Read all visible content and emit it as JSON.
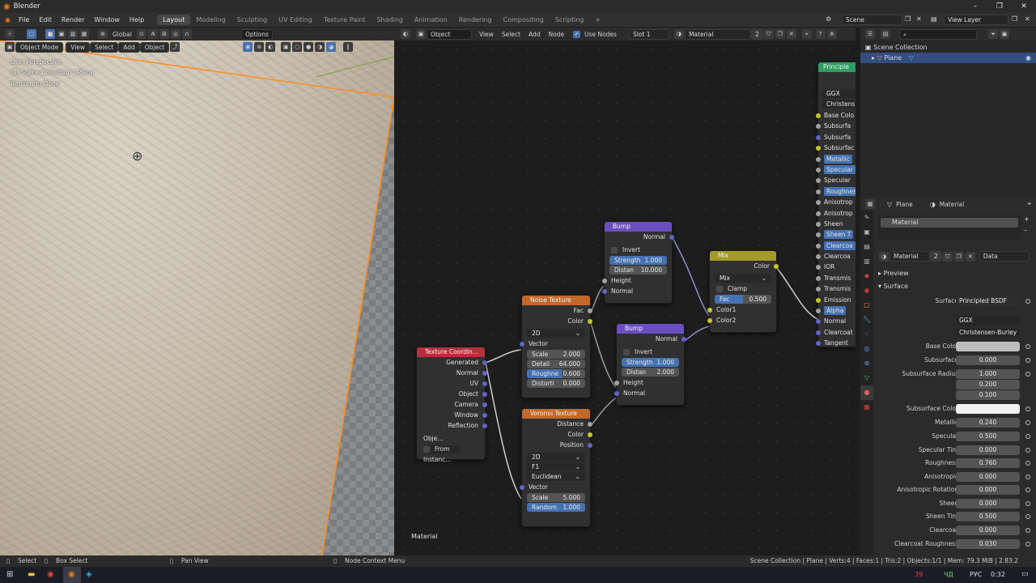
{
  "window": {
    "title": "Blender",
    "minimize": "–",
    "maximize": "❐",
    "close": "✕"
  },
  "menus": [
    "File",
    "Edit",
    "Render",
    "Window",
    "Help"
  ],
  "workspaces": [
    "Layout",
    "Modeling",
    "Sculpting",
    "UV Editing",
    "Texture Paint",
    "Shading",
    "Animation",
    "Rendering",
    "Compositing",
    "Scripting"
  ],
  "active_workspace": "Layout",
  "add_workspace": "+",
  "scene": {
    "name": "Scene",
    "view_layer": "View Layer"
  },
  "viewport": {
    "transform_orientation": "Global",
    "options_label": "Options",
    "mode": "Object Mode",
    "menus": [
      "View",
      "Select",
      "Add",
      "Object"
    ],
    "overlay_lines": [
      "User Perspective",
      "(1) Scene Collection | Plane",
      "Rendering Done"
    ]
  },
  "node_editor": {
    "type": "Object",
    "menus": [
      "View",
      "Select",
      "Add",
      "Node"
    ],
    "use_nodes_label": "Use Nodes",
    "slot": "Slot 1",
    "material": "Material",
    "users": "2",
    "footer_label": "Material",
    "nodes": {
      "texcoord": {
        "title": "Texture Coordin...",
        "outputs": [
          "Generated",
          "Normal",
          "UV",
          "Object",
          "Camera",
          "Window",
          "Reflection"
        ],
        "object_label": "Obje...",
        "from_instancer": "From Instanc..."
      },
      "noise": {
        "title": "Noise Texture",
        "outputs": [
          "Fac",
          "Color"
        ],
        "dimensions": "2D",
        "vector": "Vector",
        "fields": [
          {
            "label": "Scale",
            "value": "2.000"
          },
          {
            "label": "Detail",
            "value": "64.000"
          },
          {
            "label": "Roughne",
            "value": "0.600"
          },
          {
            "label": "Distorti",
            "value": "0.000"
          }
        ]
      },
      "voronoi": {
        "title": "Voronoi Texture",
        "outputs": [
          "Distance",
          "Color",
          "Position"
        ],
        "dimensions": "2D",
        "feature": "F1",
        "metric": "Euclidean",
        "vector": "Vector",
        "fields": [
          {
            "label": "Scale",
            "value": "5.000"
          },
          {
            "label": "Random",
            "value": "1.000"
          }
        ]
      },
      "bump1": {
        "title": "Bump",
        "output": "Normal",
        "invert": "Invert",
        "strength_label": "Strength",
        "strength": "1.000",
        "distance_label": "Distan",
        "distance": "10.000",
        "inputs": [
          "Height",
          "Normal"
        ]
      },
      "bump2": {
        "title": "Bump",
        "output": "Normal",
        "invert": "Invert",
        "strength_label": "Strength",
        "strength": "1.000",
        "distance_label": "Distan",
        "distance": "2.000",
        "inputs": [
          "Height",
          "Normal"
        ]
      },
      "mix": {
        "title": "Mix",
        "output": "Color",
        "blend": "Mix",
        "clamp": "Clamp",
        "fac_label": "Fac",
        "fac": "0.500",
        "inputs": [
          "Color1",
          "Color2"
        ]
      },
      "principled": {
        "title": "Principle",
        "distribution": "GGX",
        "sss": "Christens",
        "inputs": [
          "Base Colo",
          "Subsurfa",
          "Subsurfa",
          "Subsurfac",
          "Metallic",
          "Specular",
          "Specular",
          "Roughnes",
          "Anisotrop",
          "Anisotrop",
          "Sheen",
          "Sheen T",
          "Clearcoa",
          "Clearcoa",
          "IOR",
          "Transmis",
          "Transmis",
          "Emission",
          "Alpha",
          "Normal",
          "Clearcoat",
          "Tangent"
        ]
      }
    }
  },
  "outliner": {
    "root": "Scene Collection",
    "items": [
      {
        "label": "Plane"
      }
    ]
  },
  "properties": {
    "object": "Plane",
    "material_tab": "Material",
    "slot": "Material",
    "material_name": "Material",
    "users": "2",
    "link": "Data",
    "panels": [
      "Preview",
      "Surface"
    ],
    "surface_label": "Surface",
    "surface_value": "Principled BSDF",
    "distribution": "GGX",
    "sss_method": "Christensen-Burley",
    "rows": [
      {
        "label": "Base Color",
        "value": "",
        "fill": 0,
        "kind": "color",
        "color": "#bdbdbd"
      },
      {
        "label": "Subsurface",
        "value": "0.000",
        "fill": 0
      },
      {
        "label": "Subsurface Radius",
        "value": "1.000",
        "fill": 0
      },
      {
        "label": "",
        "value": "0.200",
        "fill": 0
      },
      {
        "label": "",
        "value": "0.100",
        "fill": 0
      },
      {
        "label": "Subsurface Color",
        "value": "",
        "fill": 0,
        "kind": "color",
        "color": "#f2f2f2"
      },
      {
        "label": "Metallic",
        "value": "0.240",
        "fill": 0.24
      },
      {
        "label": "Specular",
        "value": "0.500",
        "fill": 0.5
      },
      {
        "label": "Specular Tint",
        "value": "0.000",
        "fill": 0
      },
      {
        "label": "Roughness",
        "value": "0.760",
        "fill": 0.76
      },
      {
        "label": "Anisotropic",
        "value": "0.000",
        "fill": 0
      },
      {
        "label": "Anisotropic Rotation",
        "value": "0.000",
        "fill": 0
      },
      {
        "label": "Sheen",
        "value": "0.000",
        "fill": 0
      },
      {
        "label": "Sheen Tint",
        "value": "0.500",
        "fill": 0.5
      },
      {
        "label": "Clearcoat",
        "value": "0.000",
        "fill": 0
      },
      {
        "label": "Clearcoat Roughness",
        "value": "0.030",
        "fill": 0.03
      }
    ]
  },
  "status": {
    "select": "Select",
    "box_select": "Box Select",
    "pan_view": "Pan View",
    "context_menu": "Node Context Menu",
    "info": "Scene Collection | Plane | Verts:4 | Faces:1 | Tris:2 | Objects:1/1 | Mem: 79.3 MiB | 2.83.2"
  },
  "taskbar": {
    "badge": "39",
    "lang": "РУС",
    "time": "0:32",
    "weather": "ЧД"
  }
}
